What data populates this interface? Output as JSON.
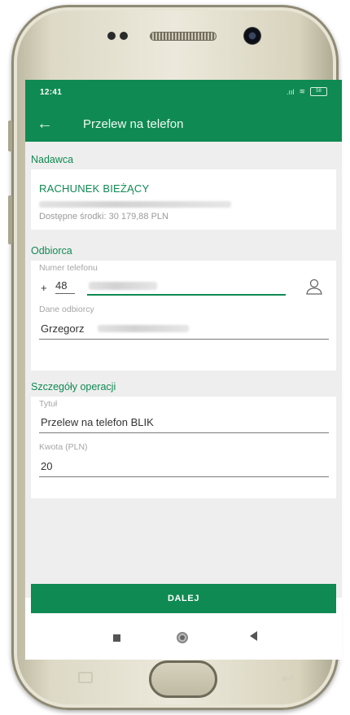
{
  "status_bar": {
    "time": "12:41",
    "signal_icon": "signal-bars-icon",
    "wifi_icon": "wifi-icon",
    "battery_label": "58"
  },
  "app_bar": {
    "back_icon": "arrow-left-icon",
    "title": "Przelew na telefon"
  },
  "sender": {
    "section_label": "Nadawca",
    "account_name": "RACHUNEK BIEŻĄCY",
    "available_funds": "Dostępne środki: 30 179,88 PLN"
  },
  "recipient": {
    "section_label": "Odbiorca",
    "phone_label": "Numer telefonu",
    "phone_plus": "+",
    "phone_prefix": "48",
    "contact_icon": "person-icon",
    "details_label": "Dane odbiorcy",
    "name_value": "Grzegorz"
  },
  "operation": {
    "section_label": "Szczegóły operacji",
    "title_label": "Tytuł",
    "title_value": "Przelew na telefon BLIK",
    "amount_label": "Kwota (PLN)",
    "amount_value": "20"
  },
  "actions": {
    "next_label": "DALEJ"
  },
  "android_nav": {
    "recent_icon": "square-recent-icon",
    "home_icon": "circle-home-icon",
    "back_icon": "triangle-back-icon"
  },
  "colors": {
    "brand_green": "#0f8a52",
    "background": "#eeeeee"
  }
}
